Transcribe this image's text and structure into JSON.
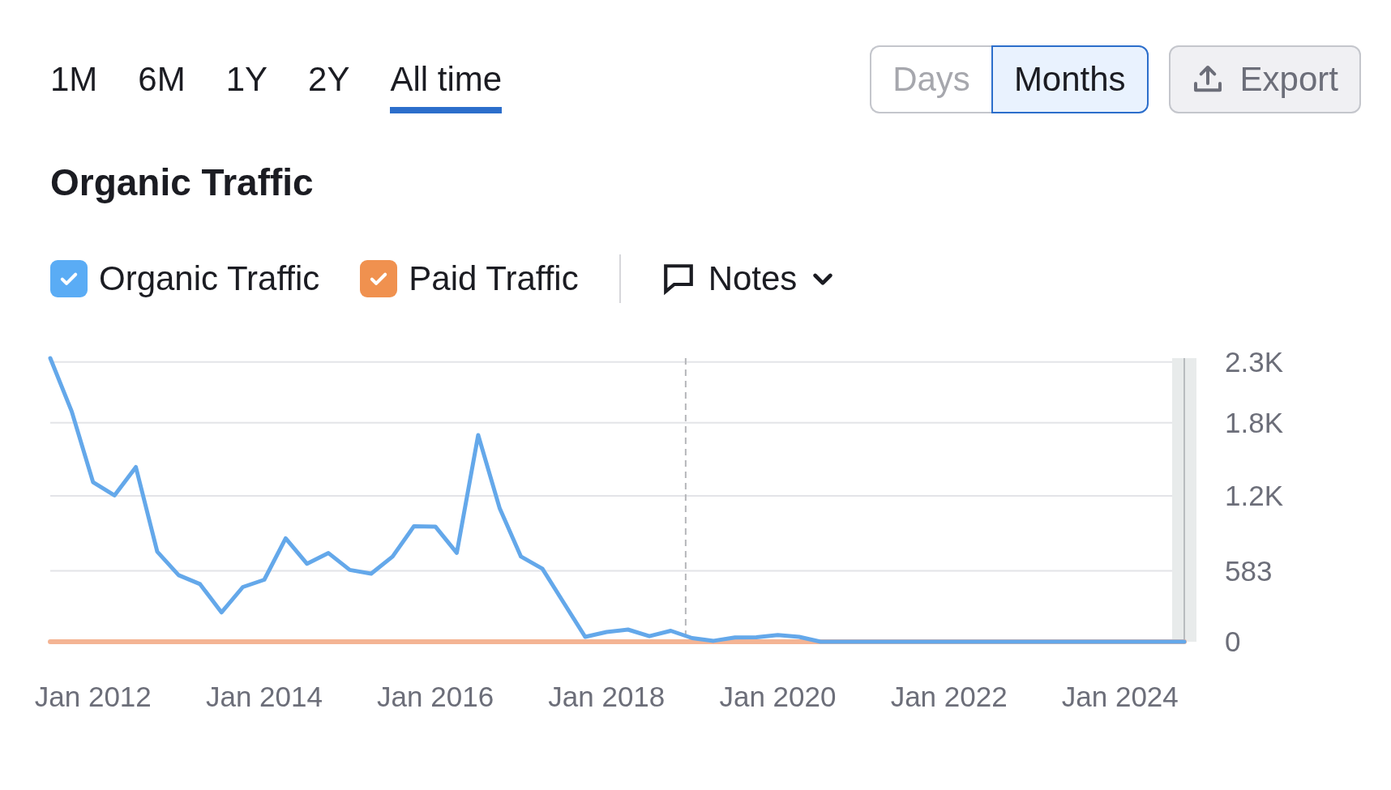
{
  "timeframes": [
    {
      "label": "1M",
      "selected": false
    },
    {
      "label": "6M",
      "selected": false
    },
    {
      "label": "1Y",
      "selected": false
    },
    {
      "label": "2Y",
      "selected": false
    },
    {
      "label": "All time",
      "selected": true
    }
  ],
  "granularity": [
    {
      "label": "Days",
      "selected": false
    },
    {
      "label": "Months",
      "selected": true
    }
  ],
  "export_button": {
    "label": "Export"
  },
  "title": "Organic Traffic",
  "legend": [
    {
      "checked": true,
      "color": "#5aacf5"
    },
    {
      "checked": true,
      "color": "#f0914f"
    }
  ],
  "notes": {
    "label": "Notes"
  },
  "chart": {
    "chart_data": {
      "type": "line",
      "categories": [
        null,
        null,
        "Jan 2012",
        null,
        null,
        null,
        null,
        null,
        null,
        null,
        "Jan 2014",
        null,
        null,
        null,
        null,
        null,
        null,
        null,
        "Jan 2016",
        null,
        null,
        null,
        null,
        null,
        null,
        null,
        "Jan 2018",
        null,
        null,
        null,
        null,
        null,
        null,
        null,
        "Jan 2020",
        null,
        null,
        null,
        null,
        null,
        null,
        null,
        "Jan 2022",
        null,
        null,
        null,
        null,
        null,
        null,
        null,
        "Jan 2024",
        null,
        null,
        null
      ],
      "series": [
        {
          "name": "Organic Traffic",
          "color": "#64a8ea",
          "values": [
            2332,
            1895,
            1312,
            1203,
            1436,
            740,
            547,
            474,
            241,
            450,
            510,
            850,
            641,
            729,
            590,
            560,
            700,
            950,
            947,
            730,
            1699,
            1100,
            700,
            600,
            320,
            40,
            80,
            100,
            45,
            90,
            30,
            7,
            35,
            36,
            55,
            40,
            0,
            0,
            0,
            0,
            0,
            0,
            0,
            0,
            0,
            0,
            0,
            0,
            0,
            0,
            0,
            0,
            0,
            0
          ]
        },
        {
          "name": "Paid Traffic",
          "color": "#f4b494",
          "values": [
            0,
            0,
            0,
            0,
            0,
            0,
            0,
            0,
            0,
            0,
            0,
            0,
            0,
            0,
            0,
            0,
            0,
            0,
            0,
            0,
            0,
            0,
            0,
            0,
            0,
            0,
            0,
            0,
            0,
            0,
            0,
            0,
            0,
            0,
            0,
            0,
            0,
            0,
            0,
            0,
            0,
            0,
            0,
            0,
            0,
            0,
            0,
            0,
            0,
            0,
            0,
            0,
            0,
            0
          ]
        }
      ],
      "ylim": [
        0,
        2332
      ],
      "yticks": [
        {
          "value": 0,
          "label": "0"
        },
        {
          "value": 583,
          "label": "583"
        },
        {
          "value": 1200,
          "label": "1.2K"
        },
        {
          "value": 1800,
          "label": "1.8K"
        },
        {
          "value": 2300,
          "label": "2.3K"
        }
      ],
      "grid": true
    }
  }
}
